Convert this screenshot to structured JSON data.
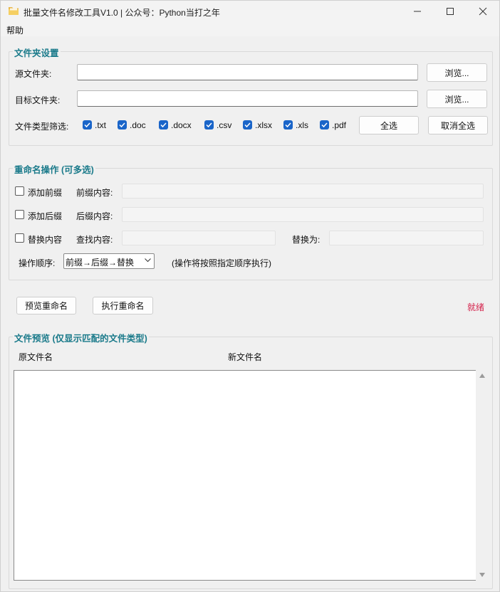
{
  "window": {
    "title": "批量文件名修改工具V1.0 | 公众号：Python当打之年",
    "icon": "folder-icon",
    "controls": {
      "minimize": "─",
      "maximize": "☐",
      "close": "✕"
    }
  },
  "menu": {
    "help": "帮助"
  },
  "folder_settings": {
    "title": "文件夹设置",
    "source_label": "源文件夹:",
    "source_value": "",
    "target_label": "目标文件夹:",
    "target_value": "",
    "browse_label": "浏览...",
    "filter_label": "文件类型筛选:",
    "file_types": [
      {
        "label": ".txt",
        "checked": true
      },
      {
        "label": ".doc",
        "checked": true
      },
      {
        "label": ".docx",
        "checked": true
      },
      {
        "label": ".csv",
        "checked": true
      },
      {
        "label": ".xlsx",
        "checked": true
      },
      {
        "label": ".xls",
        "checked": true
      },
      {
        "label": ".pdf",
        "checked": true
      }
    ],
    "select_all": "全选",
    "deselect_all": "取消全选"
  },
  "rename_ops": {
    "title": "重命名操作 (可多选)",
    "add_prefix": {
      "label": "添加前缀",
      "checked": false,
      "field_label": "前缀内容:",
      "value": ""
    },
    "add_suffix": {
      "label": "添加后缀",
      "checked": false,
      "field_label": "后缀内容:",
      "value": ""
    },
    "replace": {
      "label": "替换内容",
      "checked": false,
      "find_label": "查找内容:",
      "find_value": "",
      "replace_label": "替换为:",
      "replace_value": ""
    },
    "order_label": "操作顺序:",
    "order_value": "前缀→后缀→替换",
    "order_note": "(操作将按照指定顺序执行)"
  },
  "actions": {
    "preview": "预览重命名",
    "execute": "执行重命名",
    "status": "就绪"
  },
  "preview_panel": {
    "title": "文件预览 (仅显示匹配的文件类型)",
    "columns": [
      "原文件名",
      "新文件名"
    ],
    "rows": []
  },
  "colors": {
    "group_title": "#1a7a8a",
    "status": "#d4204a",
    "checkbox": "#1a65c9"
  }
}
